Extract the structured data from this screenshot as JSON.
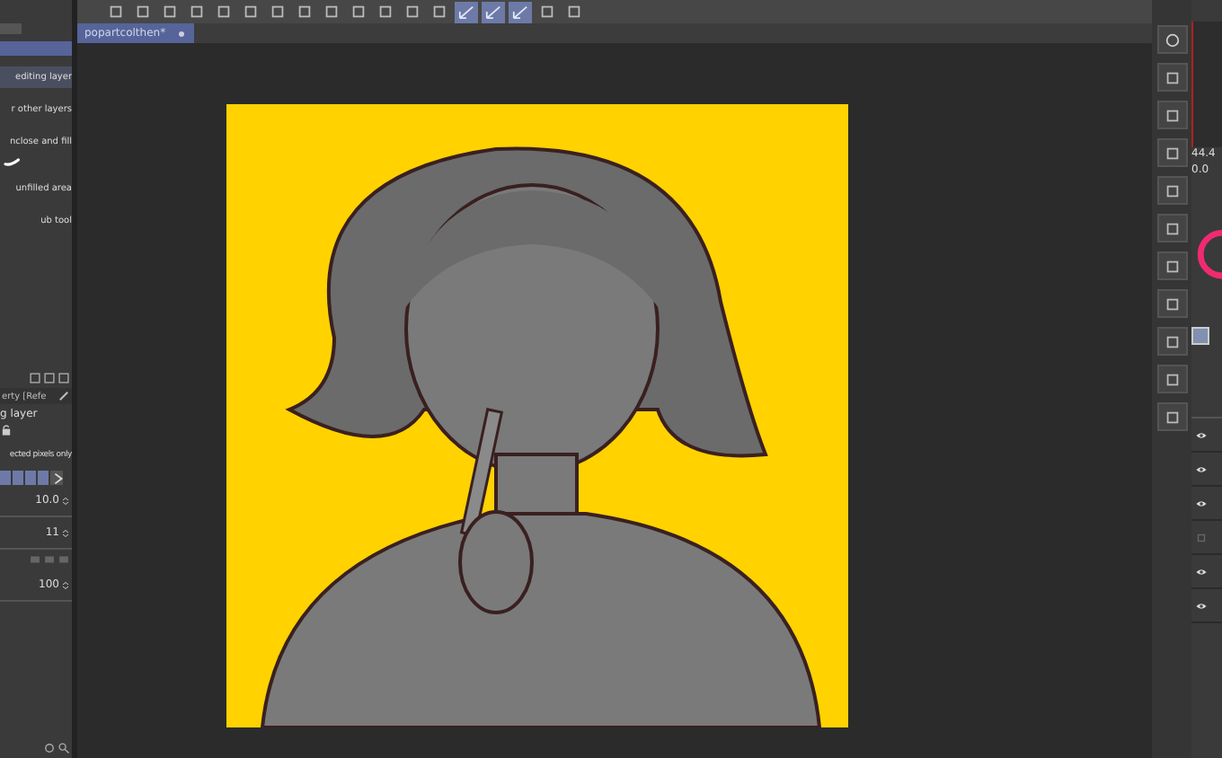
{
  "toolbar": {
    "buttons": [
      {
        "kind": "plain",
        "selected": false
      },
      {
        "kind": "plain",
        "selected": false
      },
      {
        "kind": "plain",
        "selected": false
      },
      {
        "kind": "plain",
        "selected": false
      },
      {
        "kind": "plain",
        "selected": false
      },
      {
        "kind": "plain",
        "selected": false
      },
      {
        "kind": "plain",
        "selected": false
      },
      {
        "kind": "plain",
        "selected": false
      },
      {
        "kind": "plain",
        "selected": false
      },
      {
        "kind": "plain",
        "selected": false
      },
      {
        "kind": "plain",
        "selected": false
      },
      {
        "kind": "plain",
        "selected": false
      },
      {
        "kind": "plain",
        "selected": false
      },
      {
        "kind": "check",
        "selected": true
      },
      {
        "kind": "check",
        "selected": true
      },
      {
        "kind": "check",
        "selected": true
      },
      {
        "kind": "plain",
        "selected": false
      },
      {
        "kind": "plain",
        "selected": false
      }
    ]
  },
  "document_tab": {
    "title": "popartcolthen*",
    "selected": true
  },
  "tool_options": {
    "items": [
      {
        "label": "editing layer",
        "selected": true
      },
      {
        "label": "r other layers",
        "selected": false
      },
      {
        "label": "nclose and fill",
        "selected": false
      },
      {
        "label": "unfilled area",
        "selected": false
      },
      {
        "label": "ub tool",
        "selected": false
      }
    ]
  },
  "property_panel": {
    "tab": "erty [Refe",
    "reference": "g layer",
    "option": "ected pixels only",
    "fields": [
      {
        "value": "10.0"
      },
      {
        "value": "11"
      },
      {
        "value": "100"
      }
    ]
  },
  "navigator": {
    "readings": [
      "44.4",
      "0.0"
    ]
  },
  "layers": [
    {
      "visible": true
    },
    {
      "visible": true
    },
    {
      "visible": true
    },
    {
      "visible": false
    },
    {
      "visible": true
    },
    {
      "visible": true
    }
  ]
}
